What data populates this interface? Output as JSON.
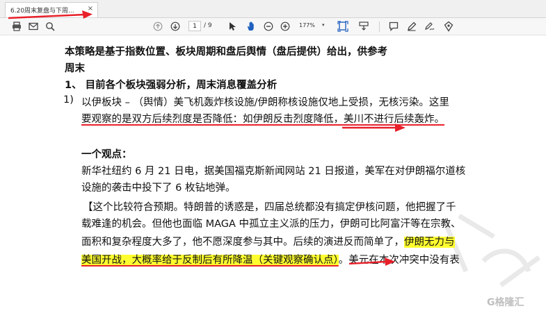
{
  "tab": {
    "title": "6.20周末复盘与下周...",
    "close": "×"
  },
  "toolbar": {
    "page_current": "1",
    "page_total": "/ 9",
    "zoom": "177%",
    "icons": [
      "print-icon",
      "email-icon",
      "search-icon",
      "page-up-icon",
      "page-down-icon",
      "cursor-icon",
      "hand-icon",
      "zoom-out-icon",
      "zoom-in-icon",
      "fit-page-icon",
      "scroll-mode-icon",
      "comment-icon",
      "pen-icon",
      "sign-icon",
      "stamp-icon"
    ]
  },
  "document": {
    "intro_line1": "本策略是基于指数位置、板块周期和盘后舆情（盘后提供）给出，供参考",
    "intro_line2": "周末",
    "section_heading": "1、 目前各个板块强弱分析，周末消息覆盖分析",
    "item_number": "1)",
    "item_line1": "以伊板块 – （舆情）美飞机轰炸核设施/伊朗称核设施仅地上受损，无核污染。这里",
    "item_line2": "要观察的是双方后续烈度是否降低：如伊朗反击烈度降低，美川不进行后续轰炸。",
    "viewpoint_heading": "一个观点：",
    "news_line1": "新华社纽约 6 月 21 日电，据美国福克斯新闻网站 21 日报道，美军在对伊朗福尔道核",
    "news_line2": "设施的袭击中投下了 6 枚钻地弹。",
    "para_line1": "【这个比较符合预期。特朗普的诱惑是，四届总统都没有搞定伊核问题，他把握了千",
    "para_line2": "载难逢的机会。但他也面临 MAGA 中孤立主义派的压力，伊朗可比阿富汗等在宗教、",
    "para_line3_plain": "面积和复杂程度大多了，他不愿深度参与其中。后续的演进反而简单了，",
    "para_line3_highlight": "伊朗无力与",
    "para_line4_highlight": "美国开战，大概率给于反制后有所降温（关键观察确认点）",
    "para_line4_plain": "。美元在本次冲突中没有表"
  },
  "watermark": {
    "logo_text": "G格隆汇"
  },
  "colors": {
    "highlight": "#ffff30",
    "annotation_red": "#e8202a",
    "toolbar_bg": "#f7f7f7"
  }
}
